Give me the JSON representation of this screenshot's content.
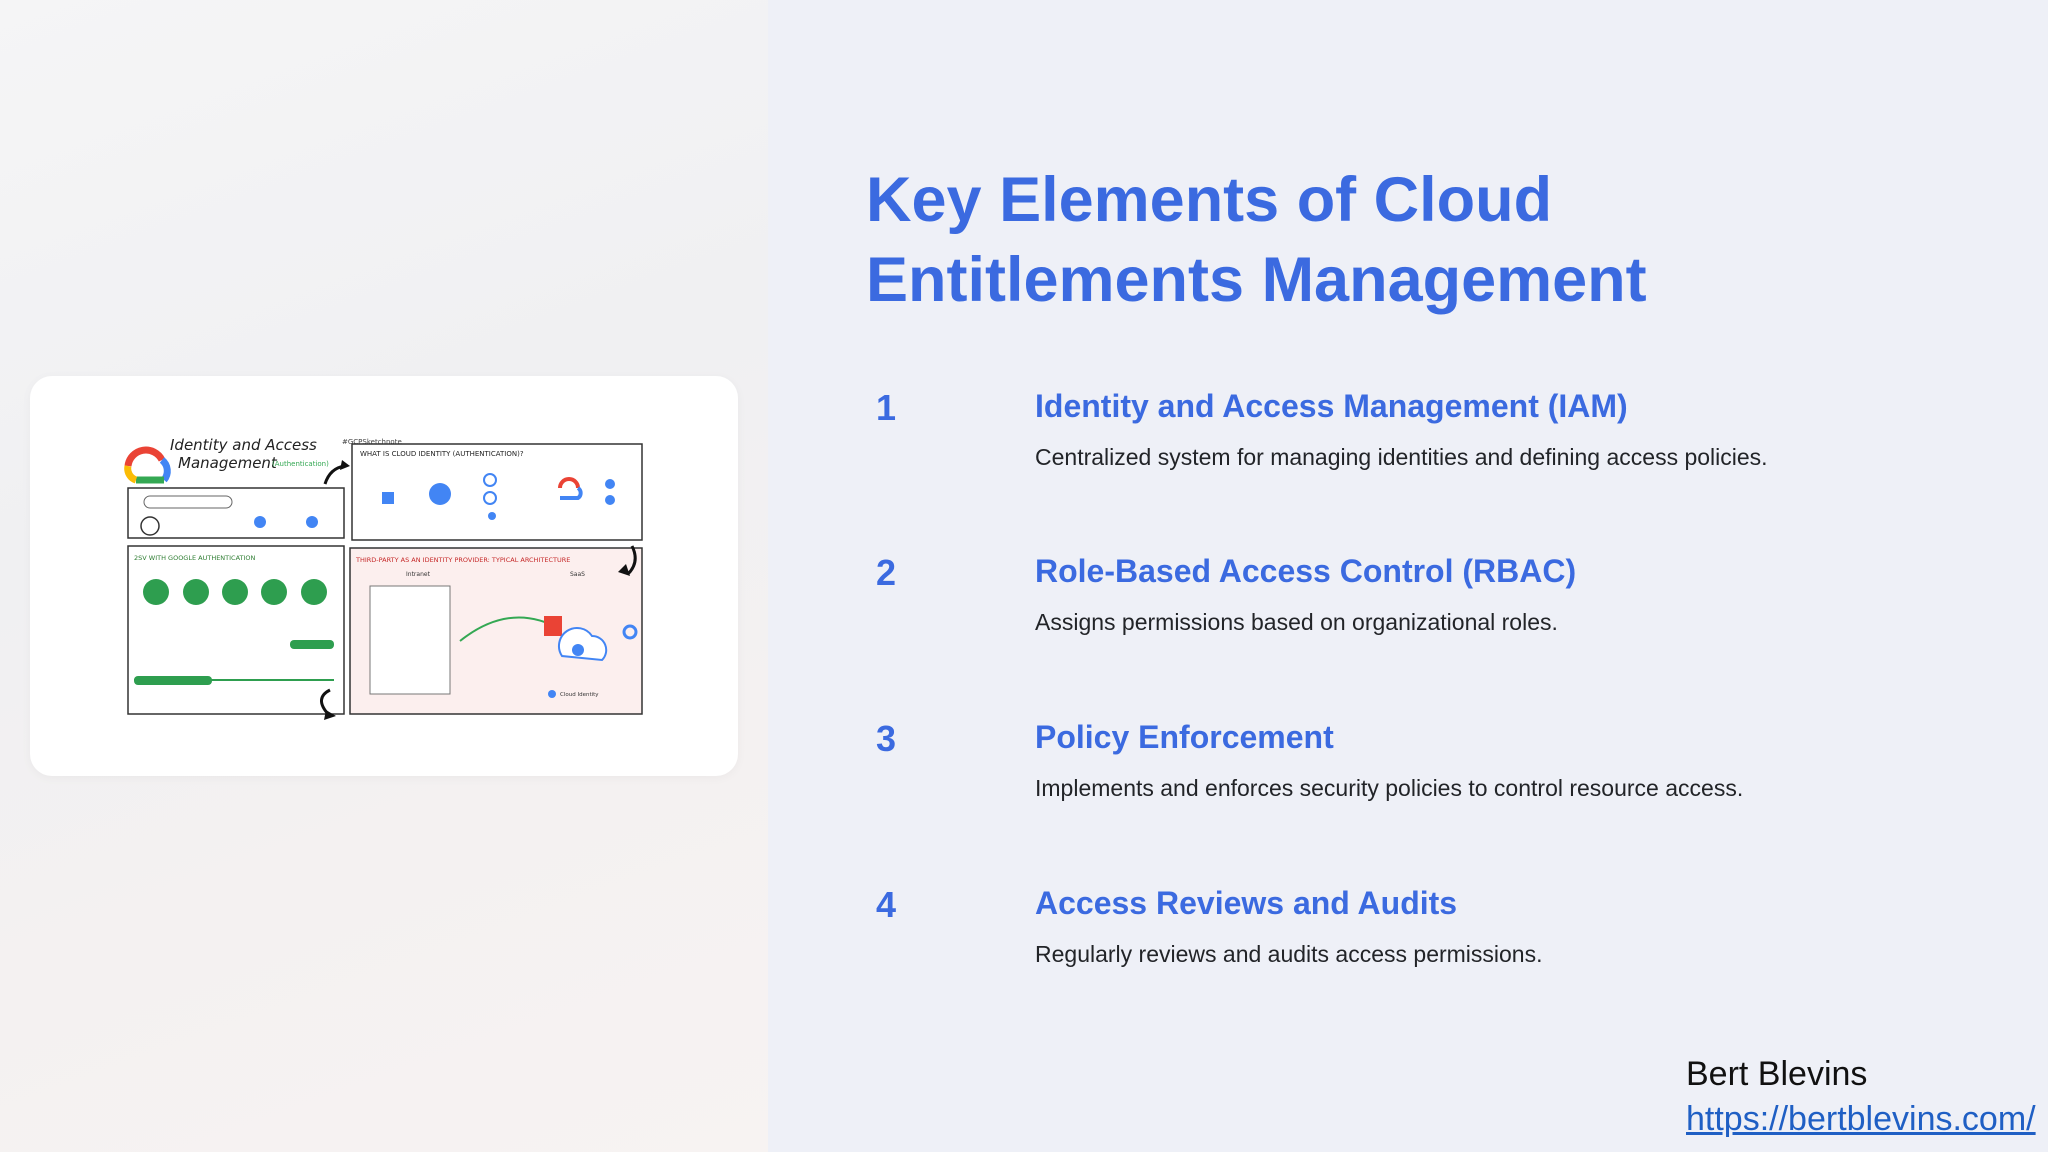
{
  "slide": {
    "title_line1": "Key Elements of Cloud",
    "title_line2": "Entitlements Management",
    "items": [
      {
        "number": "1",
        "heading": "Identity and Access Management (IAM)",
        "description": "Centralized system for managing identities and defining access policies."
      },
      {
        "number": "2",
        "heading": "Role-Based Access Control (RBAC)",
        "description": "Assigns permissions based on organizational roles."
      },
      {
        "number": "3",
        "heading": "Policy Enforcement",
        "description": "Implements and enforces security policies to control resource access."
      },
      {
        "number": "4",
        "heading": "Access Reviews and Audits",
        "description": "Regularly reviews and audits access permissions."
      }
    ]
  },
  "image": {
    "title_line1": "Identity and Access",
    "title_line2": "Management",
    "title_tag": "(Authentication)",
    "hashtag": "#GCPSketchnote",
    "panel1_title": "WHAT IS CLOUD IDENTITY (AUTHENTICATION)?",
    "panel2_title": "2SV WITH GOOGLE AUTHENTICATION",
    "panel3_title": "THIRD-PARTY AS AN IDENTITY PROVIDER: TYPICAL ARCHITECTURE",
    "intranet_label": "Intranet",
    "saas_label": "SaaS",
    "cloud_identity_label": "Cloud Identity",
    "colors": {
      "google_blue": "#4285f4",
      "google_red": "#ea4335",
      "google_yellow": "#fbbc05",
      "google_green": "#34a853",
      "pill_green": "#2e9e4f"
    }
  },
  "author": {
    "name": "Bert Blevins",
    "url": "https://bertblevins.com/"
  },
  "colors": {
    "accent": "#3b6ae0",
    "link": "#1f5fc4",
    "background": "#eef0f7"
  }
}
